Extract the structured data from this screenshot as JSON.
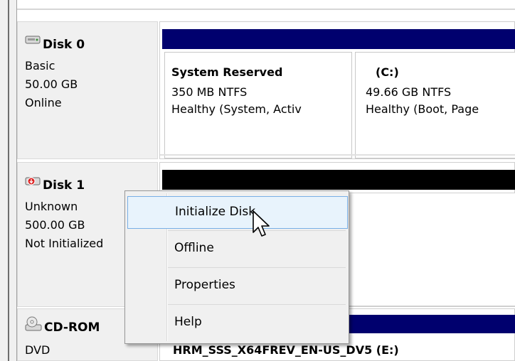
{
  "disks": [
    {
      "name": "Disk 0",
      "type": "Basic",
      "size": "50.00 GB",
      "status": "Online"
    },
    {
      "name": "Disk 1",
      "type": "Unknown",
      "size": "500.00 GB",
      "status": "Not Initialized"
    },
    {
      "name": "CD-ROM",
      "type": "DVD"
    }
  ],
  "partitions": [
    {
      "name": "System Reserved",
      "fs": "350 MB NTFS",
      "health": "Healthy (System, Activ"
    },
    {
      "name": "(C:)",
      "fs": "49.66 GB NTFS",
      "health": "Healthy (Boot, Page"
    }
  ],
  "cdrom_volume": "HRM_SSS_X64FREV_EN-US_DV5  (E:)",
  "context_menu": {
    "items": [
      "Initialize Disk",
      "Offline",
      "Properties",
      "Help"
    ],
    "highlighted": "Initialize Disk"
  },
  "colors": {
    "primary_partition_bar": "#00006e",
    "unallocated_bar": "#000000",
    "menu_highlight": "#e8f3fc"
  }
}
